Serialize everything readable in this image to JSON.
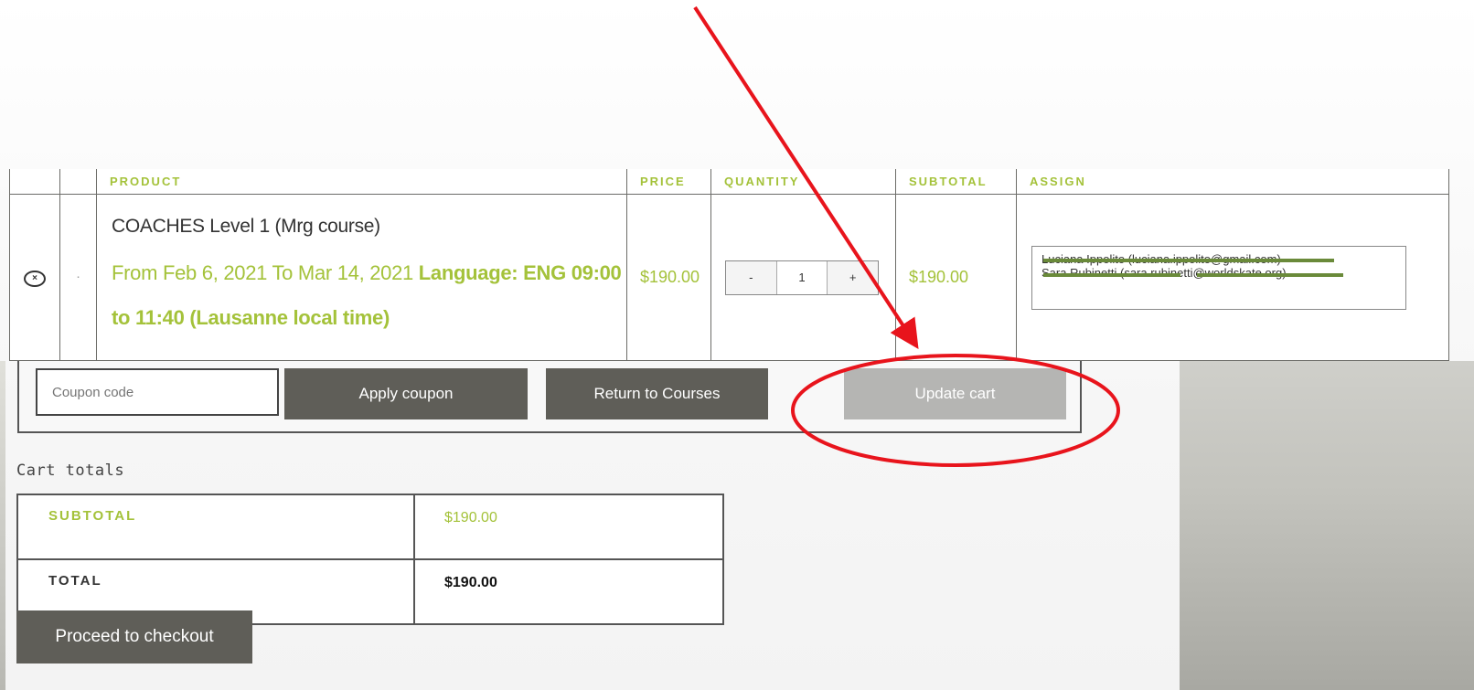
{
  "cart": {
    "headers": {
      "product": "PRODUCT",
      "price": "PRICE",
      "quantity": "QUANTITY",
      "subtotal": "SUBTOTAL",
      "assign": "ASSIGN"
    },
    "item": {
      "name": "COACHES Level 1 (Mrg course)",
      "dates": "From Feb 6, 2021 To Mar 14, 2021",
      "language": "Language: ENG 09:00 to 11:40 (Lausanne local time)",
      "price": "$190.00",
      "quantity": "1",
      "decrement": "-",
      "increment": "+",
      "subtotal": "$190.00",
      "remove_icon": "×",
      "assign_lines": [
        "Luciana Ippolito (luciana.ippolito@gmail.com)",
        "Sara Rubinetti (sara.rubinetti@worldskate.org)"
      ]
    }
  },
  "actions": {
    "coupon_placeholder": "Coupon code",
    "apply_coupon": "Apply coupon",
    "return_courses": "Return to Courses",
    "update_cart": "Update cart"
  },
  "totals": {
    "title": "Cart totals",
    "subtotal_label": "SUBTOTAL",
    "subtotal_value": "$190.00",
    "total_label": "TOTAL",
    "total_value": "$190.00"
  },
  "checkout": "Proceed to checkout",
  "colors": {
    "accent": "#a4c23a",
    "button_dark": "#5f5e58",
    "button_disabled": "#b5b5b3",
    "annotation": "#e8141c"
  }
}
